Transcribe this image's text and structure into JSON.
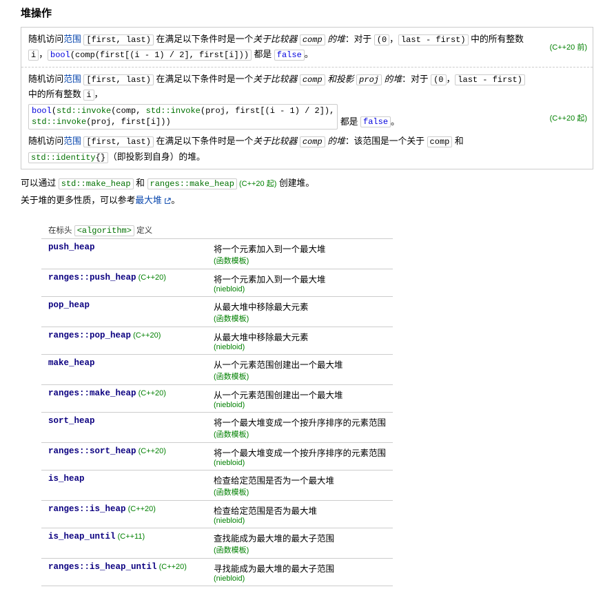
{
  "title": "堆操作",
  "box1": {
    "pre": "随机访问",
    "range_link": "范围",
    "range_code": "[first, last)",
    "mid": " 在满足以下条件时是一个",
    "ital": "关于比较器 ",
    "comp": "comp",
    "ital2": " 的堆",
    "suffix": "：对于 ",
    "open": "(0",
    "close": "last - first)",
    "mid2": " 中的所有整数 ",
    "i": "i",
    "post": "，",
    "code": "bool(comp(first[(i - 1) / 2], first[i]))",
    "end": " 都是 ",
    "false": "false",
    "dot": "。",
    "tag": "(C++20 前)"
  },
  "box2": {
    "pre": "随机访问",
    "range_link": "范围",
    "range_code": "[first, last)",
    "mid": " 在满足以下条件时是一个",
    "ital": "关于比较器 ",
    "comp": "comp",
    "ital2": " 和投影 ",
    "proj": "proj",
    "ital3": " 的堆",
    "suffix": "：对于 ",
    "open": "(0",
    "close": "last - first)",
    "mid2": " 中的所有整数 ",
    "i": "i",
    "post": "，",
    "code1_kw": "bool",
    "code1_rest1": "(",
    "code1_inv": "std::invoke",
    "code1_rest2": "(comp, ",
    "code1_inv2": "std::invoke",
    "code1_rest3": "(proj, first[(i - 1) / 2]),",
    "code1_sp": "                       ",
    "code1_inv3": "std::invoke",
    "code1_rest4": "(proj, first[i]))",
    "end": " 都是 ",
    "false": "false",
    "dot": "。",
    "tag": "(C++20 起)"
  },
  "box3": {
    "pre": "随机访问",
    "range_link": "范围",
    "range_code": "[first, last)",
    "mid": " 在满足以下条件时是一个",
    "ital": "关于比较器 ",
    "comp": "comp",
    "ital2": " 的堆",
    "suffix": "：该范围是一个关于 ",
    "comp2": "comp",
    "and": " 和 ",
    "identity": "std::identity{}",
    "ident_suffix": "（即投影到自身）的堆。"
  },
  "p1": {
    "pre": "可以通过 ",
    "make_heap": "std::make_heap",
    "mid": " 和 ",
    "ranges_make_heap": "ranges::make_heap",
    "tag": " (C++20 起)",
    "suffix": " 创建堆。"
  },
  "p2": {
    "pre": "关于堆的更多性质，可以参考",
    "link": "最大堆",
    "suffix": "。"
  },
  "table": {
    "header_pre": "在标头 ",
    "header_code": "<algorithm>",
    "header_post": " 定义",
    "rows": [
      {
        "name": "push_heap",
        "tag": "",
        "desc": "将一个元素加入到一个最大堆",
        "sub": "(函数模板)"
      },
      {
        "name": "ranges::push_heap",
        "tag": "(C++20)",
        "desc": "将一个元素加入到一个最大堆",
        "sub": "(niebloid)"
      },
      {
        "name": "pop_heap",
        "tag": "",
        "desc": "从最大堆中移除最大元素",
        "sub": "(函数模板)"
      },
      {
        "name": "ranges::pop_heap",
        "tag": "(C++20)",
        "desc": "从最大堆中移除最大元素",
        "sub": "(niebloid)"
      },
      {
        "name": "make_heap",
        "tag": "",
        "desc": "从一个元素范围创建出一个最大堆",
        "sub": "(函数模板)"
      },
      {
        "name": "ranges::make_heap",
        "tag": "(C++20)",
        "desc": "从一个元素范围创建出一个最大堆",
        "sub": "(niebloid)"
      },
      {
        "name": "sort_heap",
        "tag": "",
        "desc": "将一个最大堆变成一个按升序排序的元素范围",
        "sub": "(函数模板)"
      },
      {
        "name": "ranges::sort_heap",
        "tag": "(C++20)",
        "desc": "将一个最大堆变成一个按升序排序的元素范围",
        "sub": "(niebloid)"
      },
      {
        "name": "is_heap",
        "tag": "",
        "desc": "检查给定范围是否为一个最大堆",
        "sub": "(函数模板)"
      },
      {
        "name": "ranges::is_heap",
        "tag": "(C++20)",
        "desc": "检查给定范围是否为最大堆",
        "sub": "(niebloid)"
      },
      {
        "name": "is_heap_until",
        "tag": "(C++11)",
        "desc": "查找能成为最大堆的最大子范围",
        "sub": "(函数模板)"
      },
      {
        "name": "ranges::is_heap_until",
        "tag": "(C++20)",
        "desc": "寻找能成为最大堆的最大子范围",
        "sub": "(niebloid)"
      }
    ]
  }
}
